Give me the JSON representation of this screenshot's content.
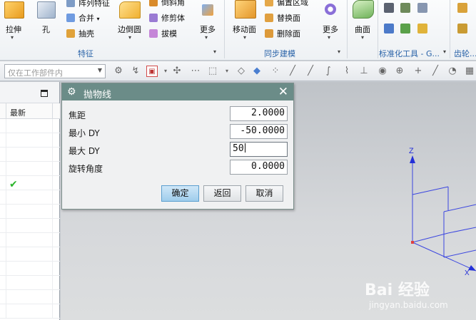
{
  "ribbon": {
    "buttons": {
      "extrude": "拉伸",
      "hole": "孔",
      "pattern_feature": "阵列特征",
      "unite": "合并",
      "shell": "抽壳",
      "edge_blend": "边倒圆",
      "chamfer": "倒斜角",
      "trim_body": "修剪体",
      "draft": "拔模",
      "more_feature": "更多",
      "move_face": "移动面",
      "offset_region": "偏置区域",
      "replace_face": "替换面",
      "delete_face": "删除面",
      "more_sync": "更多",
      "surface": "曲面"
    },
    "groups": {
      "feature": "特征",
      "synchronous_modeling": "同步建模",
      "standard_tools": "标准化工具 - G...",
      "gear": "齿轮..."
    }
  },
  "toolbar": {
    "filter_placeholder": "仅在工作部件内"
  },
  "left_panel": {
    "column_header": "最新",
    "checkmark": "✔"
  },
  "dialog": {
    "title": "抛物线",
    "fields": [
      {
        "label": "焦距",
        "value": "2.0000"
      },
      {
        "label": "最小 DY",
        "value": "-50.0000"
      },
      {
        "label": "最大 DY",
        "value": "50"
      },
      {
        "label": "旋转角度",
        "value": "0.0000"
      }
    ],
    "buttons": {
      "ok": "确定",
      "back": "返回",
      "cancel": "取消"
    }
  },
  "viewport": {
    "axis_z_label": "Z",
    "axis_x_label": "X"
  },
  "watermark": {
    "brand": "Bai 经验",
    "url": "jingyan.baidu.com"
  },
  "colors": {
    "dialog_title_bg": "#6b8c88",
    "primary_button": "#9fcdec",
    "group_label": "#2a63a8",
    "wcs_lines": "#3b46e0",
    "check": "#2bb52b"
  }
}
